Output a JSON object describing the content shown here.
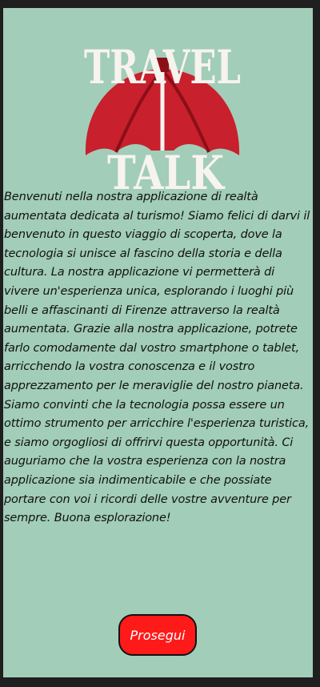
{
  "logo": {
    "word_top": "TRAVEL",
    "word_bottom": "TALK",
    "colors": {
      "dome": "#c8202c",
      "dome_dark": "#8c0f18",
      "letters": "#f7f3ee",
      "accent_letter": "#e85a2c"
    }
  },
  "intro_text": "Benvenuti nella nostra applicazione di realtà aumentata dedicata al turismo! Siamo felici di darvi il benvenuto in questo viaggio di scoperta, dove la tecnologia si unisce al fascino della storia e della cultura. La nostra applicazione vi permetterà di vivere un'esperienza unica, esplorando i luoghi più belli e affascinanti di Firenze attraverso la realtà aumentata. Grazie alla nostra applicazione, potrete farlo comodamente dal vostro smartphone o tablet, arricchendo la vostra conoscenza e il vostro apprezzamento per le meraviglie del nostro pianeta. Siamo convinti che la tecnologia possa essere un ottimo strumento per arricchire l'esperienza turistica, e siamo orgogliosi di offrirvi questa opportunità. Ci auguriamo che la vostra esperienza con la nostra applicazione sia indimenticabile e che possiate portare con voi i ricordi delle vostre avventure per sempre. Buona esplorazione!",
  "continue_button": {
    "label": "Prosegui",
    "color": "#ff1a1a"
  },
  "colors": {
    "page_background": "#1f1f1f",
    "panel_background": "#a2cdb8"
  }
}
